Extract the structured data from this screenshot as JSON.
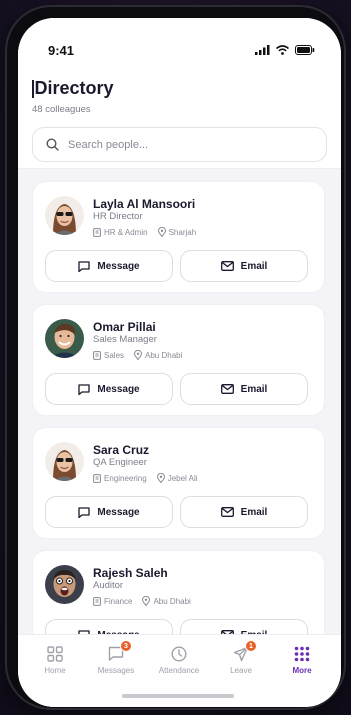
{
  "status": {
    "time": "9:41"
  },
  "header": {
    "title": "Directory",
    "subtitle": "48 colleagues"
  },
  "search": {
    "placeholder": "Search people..."
  },
  "actions": {
    "message_label": "Message",
    "email_label": "Email"
  },
  "people": [
    {
      "name": "Layla Al Mansoori",
      "role": "HR Director",
      "department": "HR & Admin",
      "location": "Sharjah",
      "avatar": "avatar-sunglasses"
    },
    {
      "name": "Omar Pillai",
      "role": "Sales Manager",
      "department": "Sales",
      "location": "Abu Dhabi",
      "avatar": "avatar-smiling"
    },
    {
      "name": "Sara Cruz",
      "role": "QA Engineer",
      "department": "Engineering",
      "location": "Jebel Ali",
      "avatar": "avatar-sunglasses"
    },
    {
      "name": "Rajesh Saleh",
      "role": "Auditor",
      "department": "Finance",
      "location": "Abu Dhabi",
      "avatar": "avatar-surprised"
    }
  ],
  "tabs": [
    {
      "label": "Home",
      "icon": "grid-icon",
      "badge": ""
    },
    {
      "label": "Messages",
      "icon": "chat-icon",
      "badge": "3"
    },
    {
      "label": "Attendance",
      "icon": "clock-icon",
      "badge": ""
    },
    {
      "label": "Leave",
      "icon": "plane-icon",
      "badge": "1"
    },
    {
      "label": "More",
      "icon": "dots-grid-icon",
      "badge": "",
      "active": true
    }
  ],
  "colors": {
    "accent": "#6b2fb3",
    "badge": "#e8622b"
  }
}
